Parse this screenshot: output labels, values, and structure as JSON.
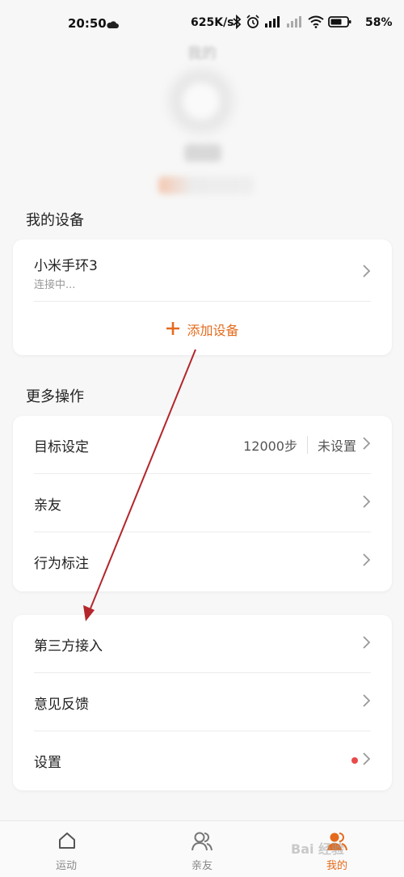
{
  "status_bar": {
    "time": "20:50",
    "speed": "625K/s",
    "battery": "58%"
  },
  "header": {
    "title": "我的"
  },
  "devices": {
    "section_title": "我的设备",
    "device_name": "小米手环3",
    "device_status": "连接中...",
    "add_label": "添加设备"
  },
  "more": {
    "section_title": "更多操作",
    "goal_label": "目标设定",
    "goal_steps": "12000步",
    "goal_status": "未设置",
    "friends_label": "亲友",
    "behavior_label": "行为标注"
  },
  "other": {
    "third_party_label": "第三方接入",
    "feedback_label": "意见反馈",
    "settings_label": "设置"
  },
  "tabs": {
    "sport": "运动",
    "friends": "亲友",
    "mine": "我的"
  },
  "watermark": "Bai 经验",
  "colors": {
    "accent": "#e46b1d",
    "annotation_arrow": "#b3262b",
    "badge": "#e84a4a"
  }
}
